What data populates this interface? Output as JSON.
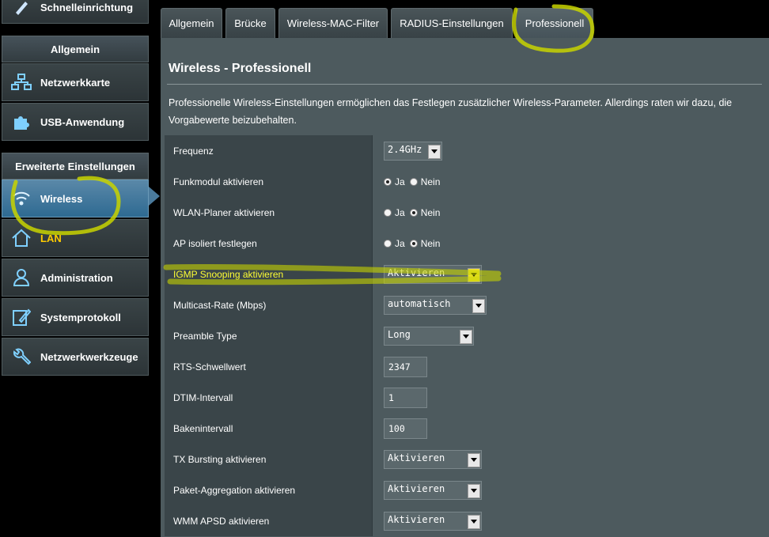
{
  "sidebar": {
    "quick_setup": "Schnelleinrichtung",
    "general_header": "Allgemein",
    "general_items": [
      {
        "label": "Netzwerkkarte",
        "icon": "network-map-icon"
      },
      {
        "label": "USB-Anwendung",
        "icon": "usb-puzzle-icon"
      }
    ],
    "advanced_header": "Erweiterte Einstellungen",
    "advanced_items": [
      {
        "label": "Wireless",
        "icon": "wifi-icon"
      },
      {
        "label": "LAN",
        "icon": "home-icon"
      },
      {
        "label": "Administration",
        "icon": "user-icon"
      },
      {
        "label": "Systemprotokoll",
        "icon": "log-edit-icon"
      },
      {
        "label": "Netzwerkwerkzeuge",
        "icon": "wrench-icon"
      }
    ]
  },
  "tabs": [
    "Allgemein",
    "Brücke",
    "Wireless-MAC-Filter",
    "RADIUS-Einstellungen",
    "Professionell"
  ],
  "panel": {
    "title": "Wireless - Professionell",
    "description": "Professionelle Wireless-Einstellungen ermöglichen das Festlegen zusätzlicher Wireless-Parameter. Allerdings raten wir dazu, die Vorgabewerte beizubehalten."
  },
  "settings": {
    "frequenz": {
      "label": "Frequenz",
      "value": "2.4GHz"
    },
    "funkmodul": {
      "label": "Funkmodul aktivieren",
      "yes": "Ja",
      "no": "Nein",
      "selected": "Ja"
    },
    "wlan_planer": {
      "label": "WLAN-Planer aktivieren",
      "yes": "Ja",
      "no": "Nein",
      "selected": "Nein"
    },
    "ap_isoliert": {
      "label": "AP isoliert festlegen",
      "yes": "Ja",
      "no": "Nein",
      "selected": "Nein"
    },
    "igmp": {
      "label": "IGMP Snooping aktivieren",
      "value": "Aktivieren"
    },
    "multicast": {
      "label": "Multicast-Rate (Mbps)",
      "value": "automatisch"
    },
    "preamble": {
      "label": "Preamble Type",
      "value": "Long"
    },
    "rts": {
      "label": "RTS-Schwellwert",
      "value": "2347"
    },
    "dtim": {
      "label": "DTIM-Intervall",
      "value": "1"
    },
    "beacon": {
      "label": "Bakenintervall",
      "value": "100"
    },
    "tx_bursting": {
      "label": "TX Bursting aktivieren",
      "value": "Aktivieren"
    },
    "aggregation": {
      "label": "Paket-Aggregation aktivieren",
      "value": "Aktivieren"
    },
    "wmm_apsd": {
      "label": "WMM APSD aktivieren",
      "value": "Aktivieren"
    }
  },
  "colors": {
    "highlight_marker": "#c8d400",
    "active_nav": "#2e6a92",
    "panel_bg": "#4d5a5e"
  }
}
